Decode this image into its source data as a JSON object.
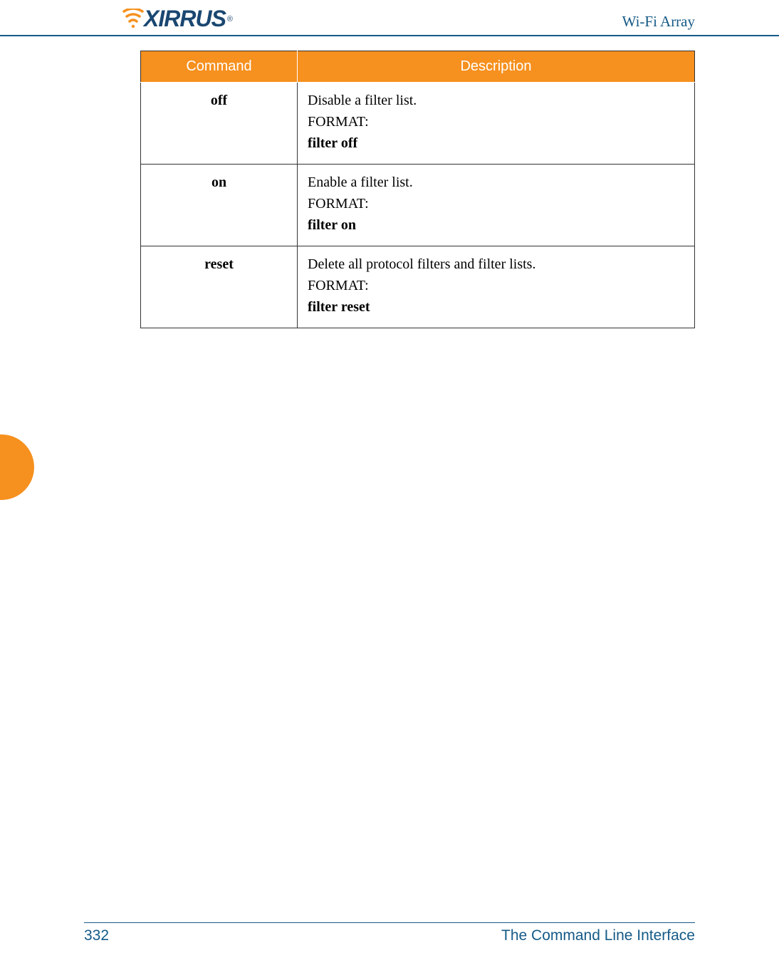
{
  "header": {
    "logo_text": "XIRRUS",
    "logo_reg": "®",
    "title": "Wi-Fi Array"
  },
  "table": {
    "headers": {
      "command": "Command",
      "description": "Description"
    },
    "rows": [
      {
        "command": "off",
        "desc_text": "Disable a filter list.",
        "format_label": "FORMAT:",
        "format_value": "filter off"
      },
      {
        "command": "on",
        "desc_text": "Enable a filter list.",
        "format_label": "FORMAT:",
        "format_value": "filter on"
      },
      {
        "command": "reset",
        "desc_text": "Delete all protocol filters and filter lists.",
        "format_label": "FORMAT:",
        "format_value": "filter reset"
      }
    ]
  },
  "footer": {
    "page_number": "332",
    "section": "The Command Line Interface"
  }
}
